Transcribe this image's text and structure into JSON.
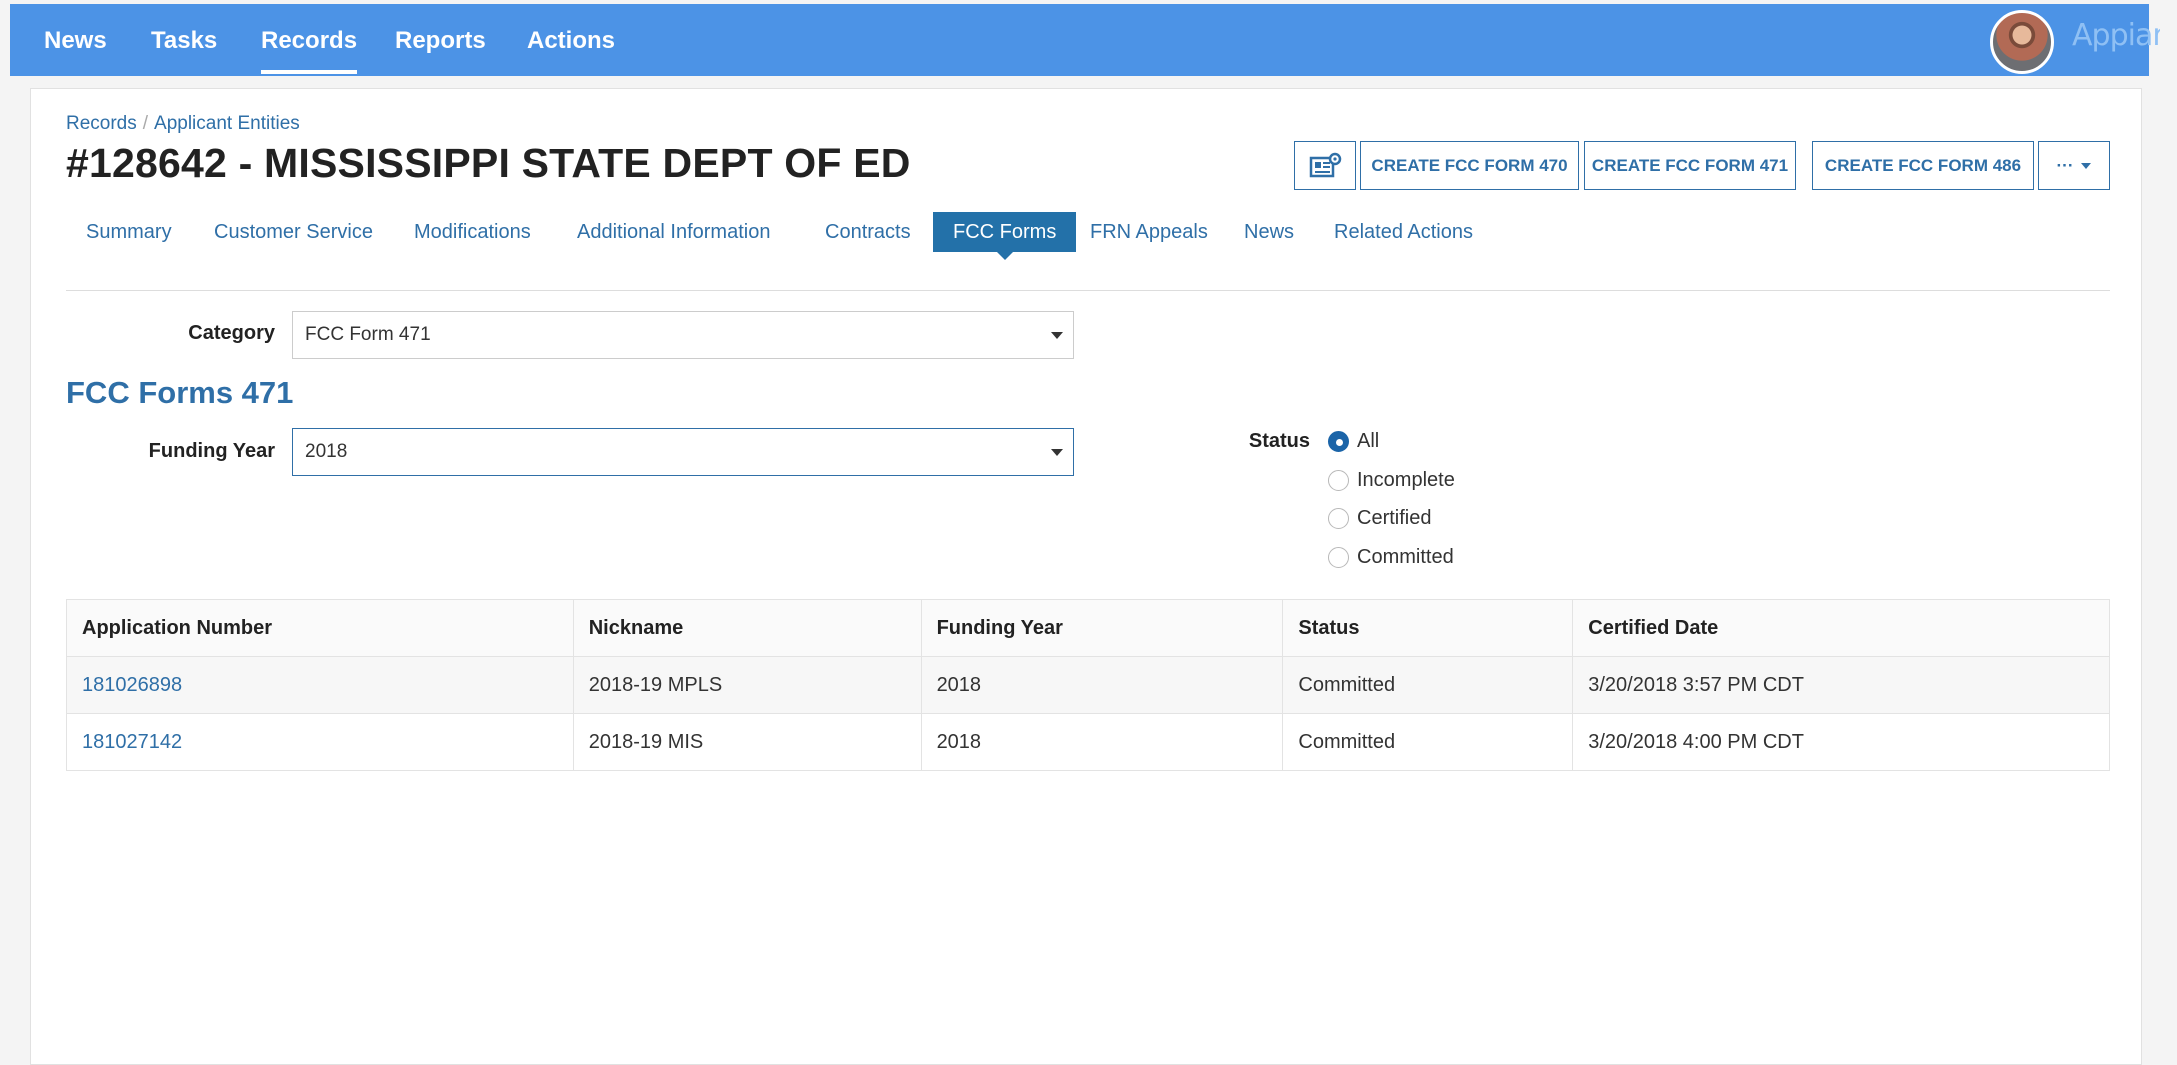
{
  "nav": {
    "items": [
      "News",
      "Tasks",
      "Records",
      "Reports",
      "Actions"
    ],
    "active": "Records",
    "brand": "Appian"
  },
  "breadcrumb": {
    "root": "Records",
    "separator": "/",
    "current": "Applicant Entities"
  },
  "title": "#128642 - MISSISSIPPI STATE DEPT OF ED",
  "actions": {
    "icon": "newspaper-gear-icon",
    "create470": "CREATE FCC FORM 470",
    "create471": "CREATE FCC FORM 471",
    "create486": "CREATE FCC FORM 486",
    "more": "···"
  },
  "tabs": [
    "Summary",
    "Customer Service",
    "Modifications",
    "Additional Information",
    "Contracts",
    "FCC Forms",
    "FRN Appeals",
    "News",
    "Related Actions"
  ],
  "active_tab": "FCC Forms",
  "category": {
    "label": "Category",
    "value": "FCC Form 471"
  },
  "section_title": "FCC Forms 471",
  "funding_year": {
    "label": "Funding Year",
    "value": "2018"
  },
  "status_filter": {
    "label": "Status",
    "options": [
      "All",
      "Incomplete",
      "Certified",
      "Committed"
    ],
    "selected": "All"
  },
  "table": {
    "columns": [
      "Application Number",
      "Nickname",
      "Funding Year",
      "Status",
      "Certified Date"
    ],
    "rows": [
      [
        "181026898",
        "2018-19 MPLS",
        "2018",
        "Committed",
        "3/20/2018 3:57 PM CDT"
      ],
      [
        "181027142",
        "2018-19 MIS",
        "2018",
        "Committed",
        "3/20/2018 4:00 PM CDT"
      ]
    ]
  },
  "colors": {
    "nav": "#4c93e6",
    "link": "#2f6fa7",
    "active_tab": "#2371a9"
  }
}
